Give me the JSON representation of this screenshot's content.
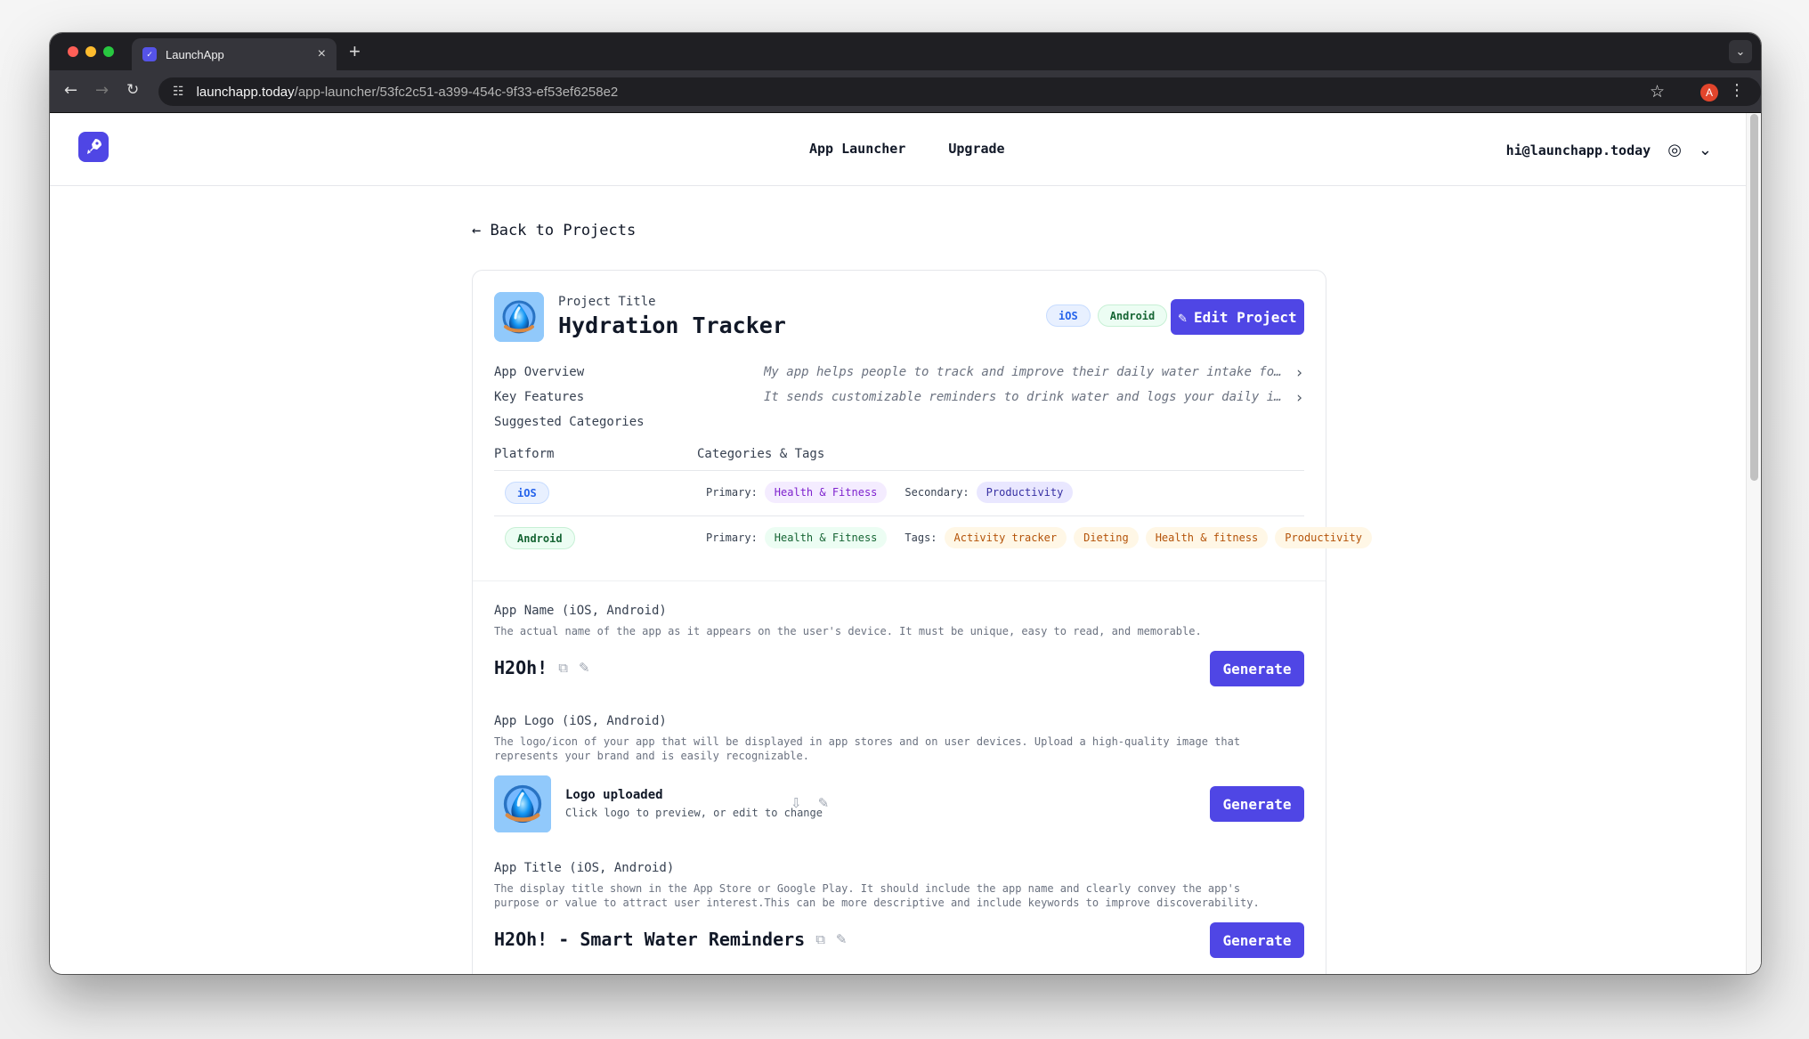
{
  "browser": {
    "tab_title": "LaunchApp",
    "tab_icon": "launchapp-rocket-icon",
    "url_host": "launchapp.today",
    "url_path": "/app-launcher/53fc2c51-a399-454c-9f33-ef53ef6258e2",
    "profile_initial": "A"
  },
  "site": {
    "nav": {
      "app_launcher": "App Launcher",
      "upgrade": "Upgrade"
    },
    "account_email": "hi@launchapp.today"
  },
  "back_link": "← Back to Projects",
  "project": {
    "label": "Project Title",
    "title": "Hydration Tracker",
    "platform_ios": "iOS",
    "platform_android": "Android",
    "edit_button": "Edit Project",
    "app_overview_label": "App Overview",
    "app_overview_value": "My app helps people to track and improve their daily water intake for better hea...",
    "key_features_label": "Key Features",
    "key_features_value": "It sends customizable reminders to drink water and logs your daily intake with o...",
    "suggested_categories_label": "Suggested Categories",
    "platform_header": "Platform",
    "categories_header": "Categories & Tags"
  },
  "categories": {
    "primary_label": "Primary:",
    "secondary_label": "Secondary:",
    "tags_label": "Tags:",
    "ios_primary": "Health & Fitness",
    "ios_secondary": "Productivity",
    "android_primary": "Health & Fitness",
    "tags": [
      "Activity tracker",
      "Dieting",
      "Health & fitness",
      "Productivity"
    ]
  },
  "fields": {
    "app_name": {
      "title": "App Name (iOS, Android)",
      "description": "The actual name of the app as it appears on the user's device. It must be unique, easy to read, and memorable.",
      "value": "H2Oh!",
      "generate": "Generate"
    },
    "app_logo": {
      "title": "App Logo (iOS, Android)",
      "description": "The logo/icon of your app that will be displayed in app stores and on user devices. Upload a high-quality image that represents your brand and is easily recognizable.",
      "status": "Logo uploaded",
      "help": "Click logo to preview, or edit to change",
      "generate": "Generate"
    },
    "app_title": {
      "title": "App Title (iOS, Android)",
      "description": "The display title shown in the App Store or Google Play. It should include the app name and clearly convey the app's purpose or value to attract user interest.This can be more descriptive and include keywords to improve discoverability.",
      "value": "H2Oh! - Smart Water Reminders",
      "generate": "Generate"
    }
  },
  "colors": {
    "accent": "#4f46e5",
    "ios_pill": "#e8f0ff",
    "android_pill": "#ecfdf3",
    "tag_orange": "#fff7e6"
  }
}
